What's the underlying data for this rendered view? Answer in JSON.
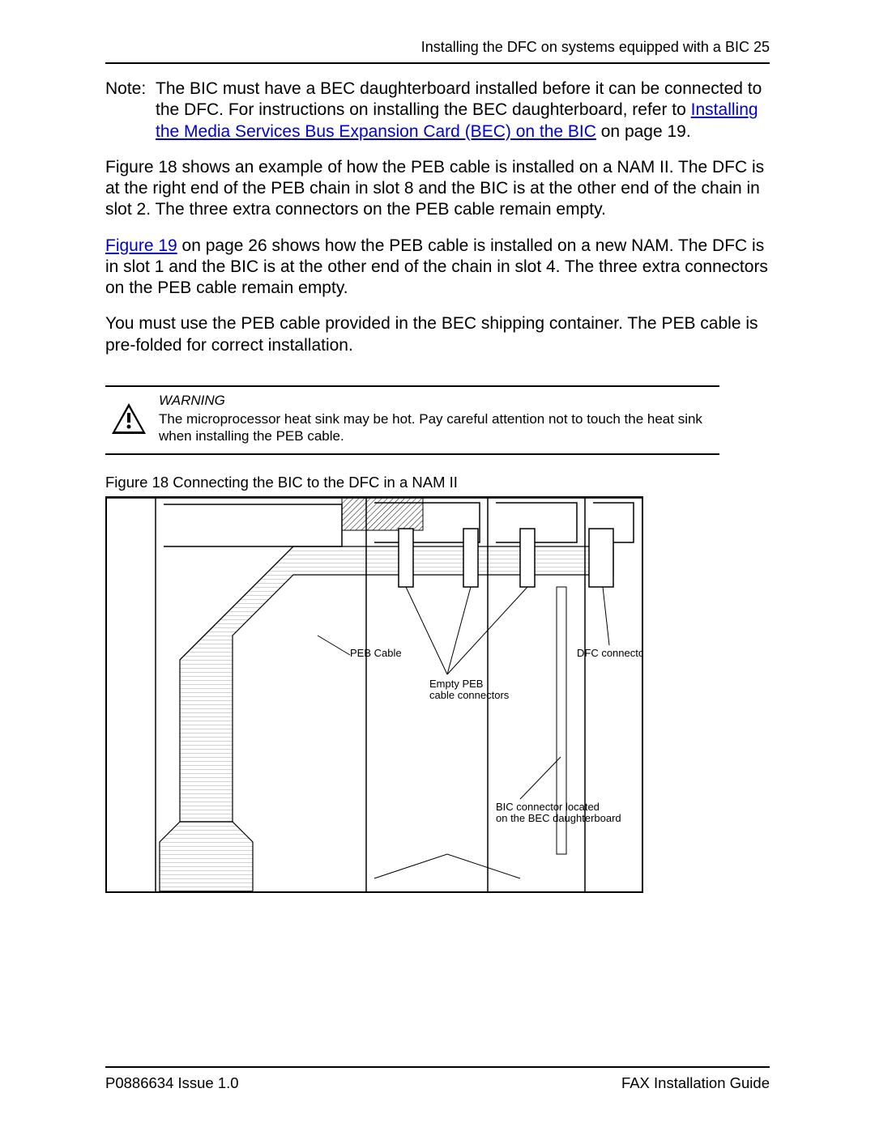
{
  "header": {
    "title_left": "Installing the DFC on systems equipped with a BIC",
    "page_number": "25"
  },
  "note": {
    "label": "Note:",
    "text_before_link": "The BIC must have a BEC daughterboard installed before it can be connected to the DFC. For instructions on installing the BEC daughterboard, refer to ",
    "link_text": "Installing the Media Services Bus Expansion Card (BEC) on the BIC",
    "text_after_link": " on page 19."
  },
  "paragraphs": {
    "p1": "Figure 18 shows an example of how the PEB cable is installed on a NAM II. The DFC is at the right end of the PEB  chain  in slot 8 and the BIC is at the other end of the chain in slot 2. The three extra connectors on the PEB cable remain empty.",
    "p2_link": "Figure 19",
    "p2_rest": " on page 26 shows how the PEB cable is installed on a new NAM. The DFC is in slot 1 and the BIC is at the other end of the chain in slot 4. The three extra connectors on the PEB cable remain empty.",
    "p3": "You must use the PEB cable provided in the BEC shipping container. The PEB cable is pre-folded for correct installation."
  },
  "warning": {
    "heading": "WARNING",
    "body": "The microprocessor heat sink may be hot. Pay careful attention not to touch the heat sink when installing the PEB cable."
  },
  "figure": {
    "caption": "Figure 18 Connecting the BIC to the DFC in a NAM II",
    "labels": {
      "peb_cable": "PEB Cable",
      "empty_peb": "Empty PEB",
      "cable_connectors": "cable connectors",
      "dfc_connector": "DFC connector",
      "bic_conn_1": "BIC connector located",
      "bic_conn_2": "on the BEC daughterboard"
    }
  },
  "footer": {
    "left": "P0886634 Issue 1.0",
    "right": "FAX Installation Guide"
  }
}
